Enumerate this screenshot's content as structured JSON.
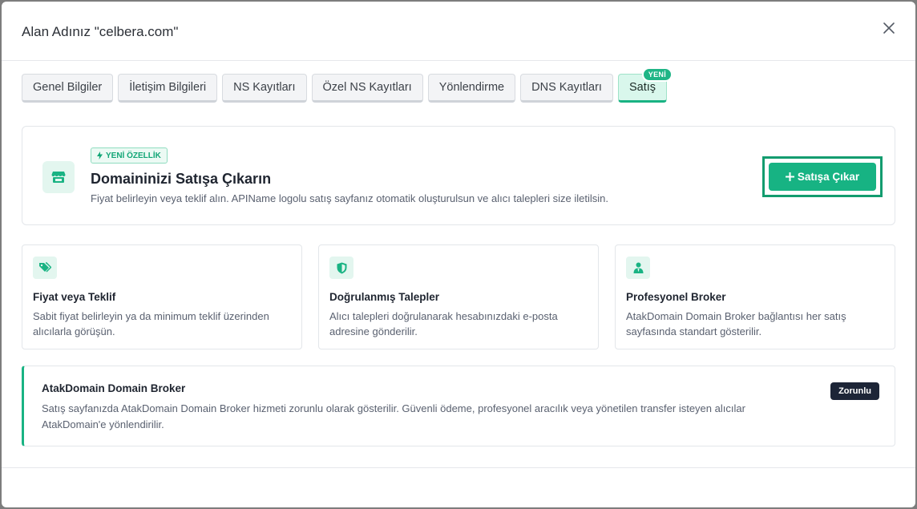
{
  "modal": {
    "title": "Alan Adınız \"celbera.com\"",
    "close_icon": "close-icon"
  },
  "tabs": [
    {
      "label": "Genel Bilgiler",
      "active": false
    },
    {
      "label": "İletişim Bilgileri",
      "active": false
    },
    {
      "label": "NS Kayıtları",
      "active": false
    },
    {
      "label": "Özel NS Kayıtları",
      "active": false
    },
    {
      "label": "Yönlendirme",
      "active": false
    },
    {
      "label": "DNS Kayıtları",
      "active": false
    },
    {
      "label": "Satış",
      "active": true,
      "badge": "YENİ"
    }
  ],
  "hero": {
    "icon": "store-icon",
    "badge": "YENİ ÖZELLİK",
    "badge_icon": "bolt-icon",
    "title": "Domaininizi Satışa Çıkarın",
    "description": "Fiyat belirleyin veya teklif alın. APIName logolu satış sayfanız otomatik oluşturulsun ve alıcı talepleri size iletilsin.",
    "cta_label": "Satışa Çıkar",
    "cta_icon": "plus-icon"
  },
  "features": [
    {
      "icon": "tag-icon",
      "title": "Fiyat veya Teklif",
      "description": "Sabit fiyat belirleyin ya da minimum teklif üzerinden alıcılarla görüşün."
    },
    {
      "icon": "shield-icon",
      "title": "Doğrulanmış Talepler",
      "description": "Alıcı talepleri doğrulanarak hesabınızdaki e-posta adresine gönderilir."
    },
    {
      "icon": "user-tie-icon",
      "title": "Profesyonel Broker",
      "description": "AtakDomain Domain Broker bağlantısı her satış sayfasında standart gösterilir."
    }
  ],
  "broker": {
    "title": "AtakDomain Domain Broker",
    "description": "Satış sayfanızda AtakDomain Domain Broker hizmeti zorunlu olarak gösterilir. Güvenli ödeme, profesyonel aracılık veya yönetilen transfer isteyen alıcılar AtakDomain'e yönlendirilir.",
    "badge": "Zorunlu"
  },
  "colors": {
    "accent": "#17b383",
    "accent_light": "#e3f6ef",
    "dark_badge": "#1d2537"
  }
}
